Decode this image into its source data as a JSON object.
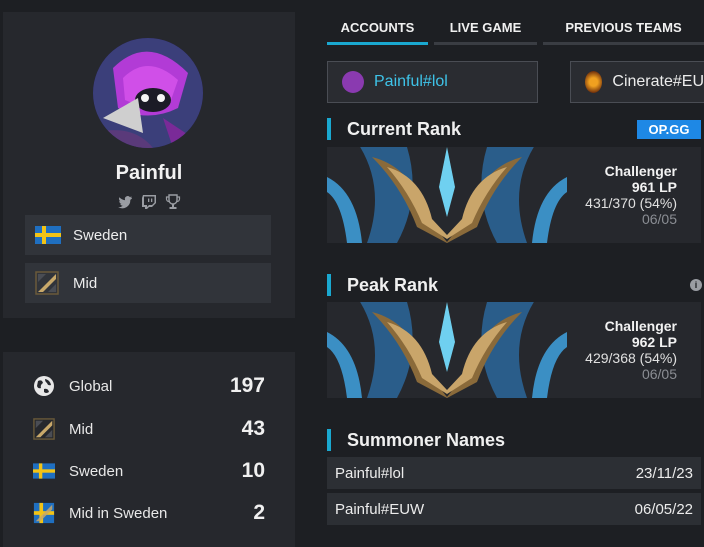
{
  "profile": {
    "name": "Painful",
    "socials": [
      "twitter-icon",
      "twitch-icon",
      "trophy-icon"
    ],
    "country": "Sweden",
    "role": "Mid"
  },
  "stats": [
    {
      "icon": "globe-icon",
      "label": "Global",
      "value": "197"
    },
    {
      "icon": "mid-lane-icon",
      "label": "Mid",
      "value": "43"
    },
    {
      "icon": "sweden-flag-icon",
      "label": "Sweden",
      "value": "10"
    },
    {
      "icon": "mid-sweden-icon",
      "label": "Mid in Sweden",
      "value": "2"
    }
  ],
  "tabs": [
    {
      "label": "ACCOUNTS",
      "active": true
    },
    {
      "label": "LIVE GAME",
      "active": false
    },
    {
      "label": "PREVIOUS TEAMS",
      "active": false
    }
  ],
  "accounts": [
    {
      "name": "Painful#lol",
      "color": "#3ec3e8"
    },
    {
      "name": "Cinerate#EU",
      "color": "#ececec"
    }
  ],
  "current_rank": {
    "title": "Current Rank",
    "badge": "OP.GG",
    "tier": "Challenger",
    "lp": "961 LP",
    "record": "431/370 (54%)",
    "date": "06/05"
  },
  "peak_rank": {
    "title": "Peak Rank",
    "tier": "Challenger",
    "lp": "962 LP",
    "record": "429/368 (54%)",
    "date": "06/05"
  },
  "summoner_names": {
    "title": "Summoner Names",
    "rows": [
      {
        "name": "Painful#lol",
        "date": "23/11/23"
      },
      {
        "name": "Painful#EUW",
        "date": "06/05/22"
      }
    ]
  },
  "colors": {
    "accent": "#1aa8d0",
    "link": "#3ec3e8",
    "badge": "#1e88e5"
  }
}
